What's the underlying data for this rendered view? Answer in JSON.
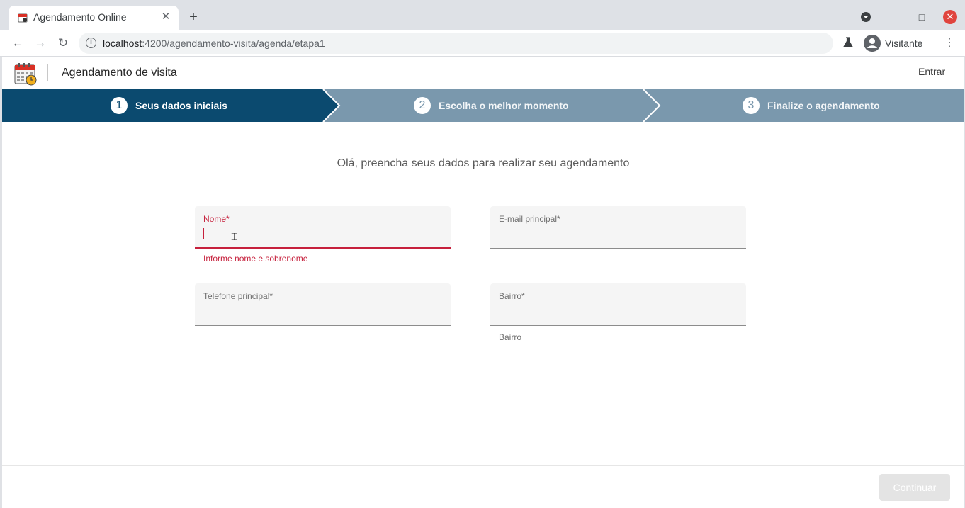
{
  "browser": {
    "tab_title": "Agendamento Online",
    "tab_close": "✕",
    "new_tab": "+",
    "url_host": "localhost",
    "url_path": ":4200/agendamento-visita/agenda/etapa1",
    "profile_name": "Visitante",
    "window_controls": {
      "minimize": "–",
      "maximize": "□",
      "close": "✕"
    }
  },
  "app": {
    "title": "Agendamento de visita",
    "login": "Entrar",
    "steps": [
      {
        "number": "1",
        "label": "Seus dados iniciais",
        "state": "active"
      },
      {
        "number": "2",
        "label": "Escolha o melhor momento",
        "state": "pending"
      },
      {
        "number": "3",
        "label": "Finalize o agendamento",
        "state": "pending"
      }
    ],
    "intro": "Olá, preencha seus dados para realizar seu agendamento",
    "form": {
      "nome": {
        "label": "Nome*",
        "value": "",
        "error": "Informe nome e sobrenome"
      },
      "email": {
        "label": "E-mail principal*",
        "value": ""
      },
      "telefone": {
        "label": "Telefone principal*",
        "value": ""
      },
      "bairro": {
        "label": "Bairro*",
        "value": "",
        "hint": "Bairro"
      }
    },
    "continue": "Continuar"
  },
  "colors": {
    "step_active": "#0b4a6f",
    "step_inactive": "#7a98ad",
    "error": "#c6203c"
  }
}
